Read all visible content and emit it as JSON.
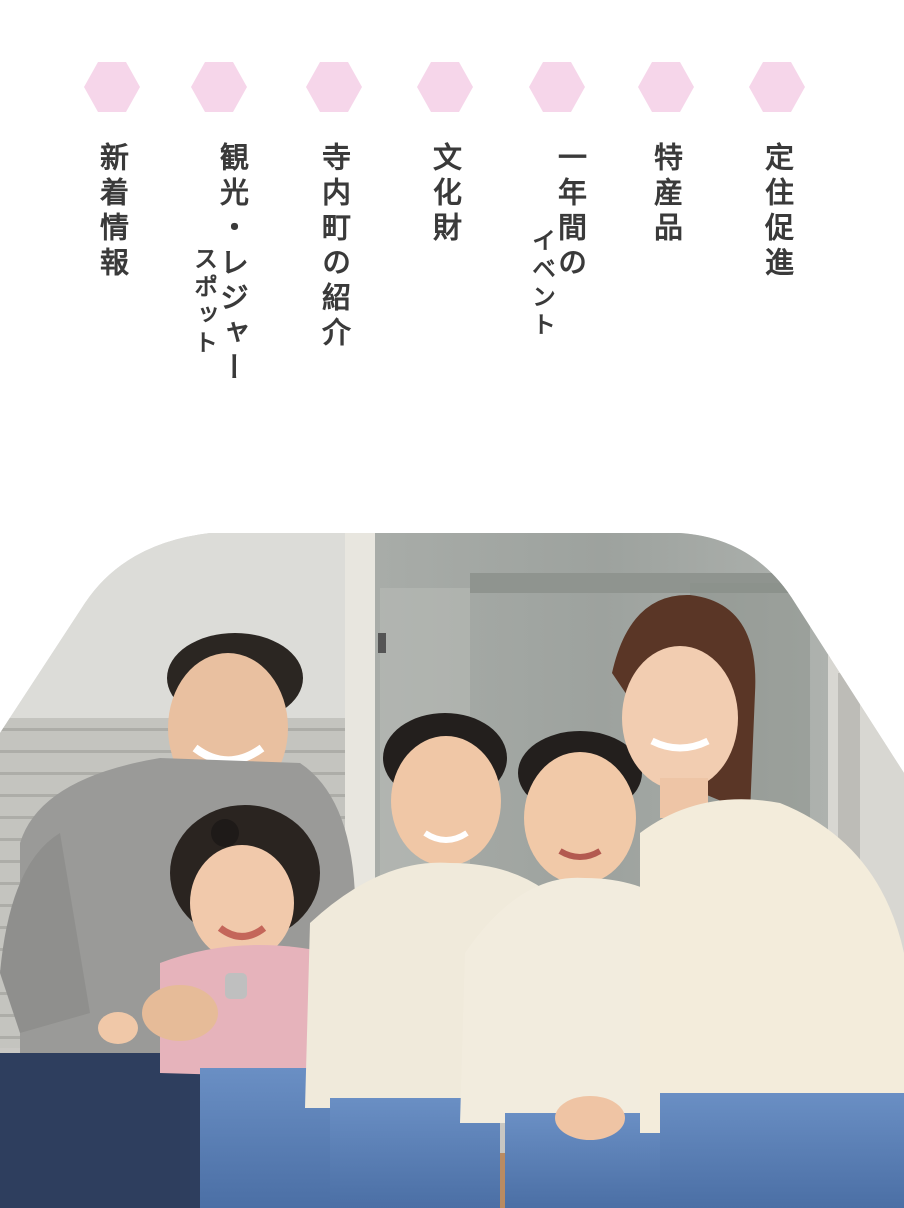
{
  "nav": {
    "items": [
      {
        "label": "定住促進"
      },
      {
        "label": "特産品"
      },
      {
        "label": "一年間の",
        "sub": "イベント"
      },
      {
        "label": "文化財"
      },
      {
        "label": "寺内町の紹介"
      },
      {
        "label": "観光・レジャー",
        "sub": "スポット"
      },
      {
        "label": "新着情報"
      }
    ],
    "hex_color": "#f6d6ea"
  },
  "hero": {
    "image": "family-photo"
  }
}
